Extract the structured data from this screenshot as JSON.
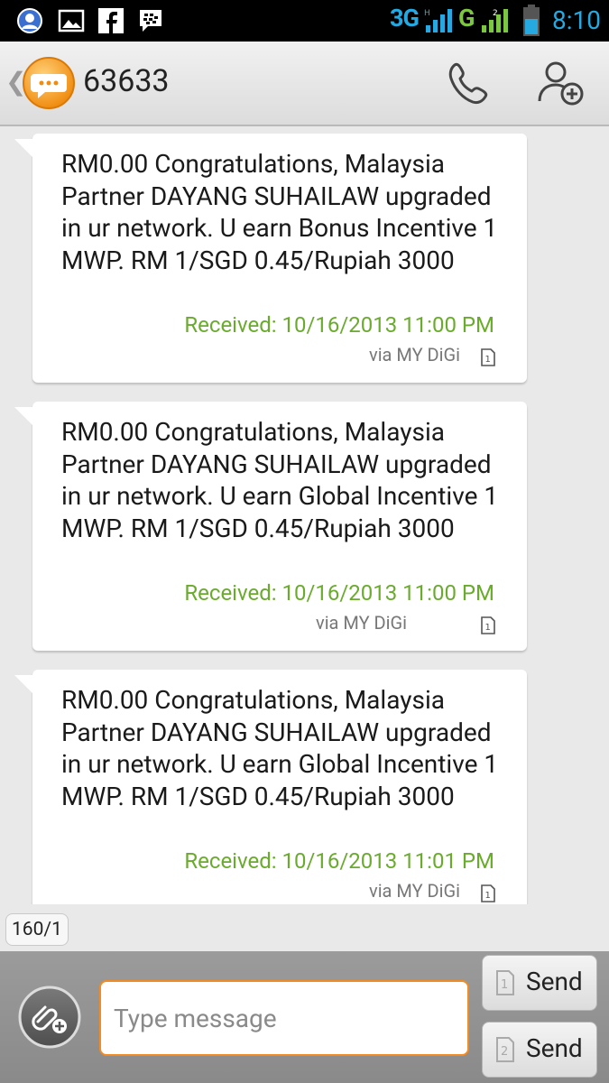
{
  "status_bar": {
    "network": "3G",
    "network_g": "G",
    "time": "8:10"
  },
  "header": {
    "title": "63633"
  },
  "messages": [
    {
      "body": "RM0.00 Congratulations, Malaysia Partner DAYANG SUHAILAW upgraded in ur network. U earn Bonus Incentive 1 MWP. RM 1/SGD 0.45/Rupiah 3000",
      "received": "Received: 10/16/2013 11:00 PM",
      "via": "via MY DiGi",
      "sim": "1"
    },
    {
      "body": "RM0.00 Congratulations, Malaysia Partner DAYANG SUHAILAW upgraded in ur network. U earn Global Incentive 1 MWP. RM 1/SGD 0.45/Rupiah 3000",
      "received": "Received: 10/16/2013 11:00 PM",
      "via": "via MY DiGi",
      "sim": "1"
    },
    {
      "body": "RM0.00 Congratulations, Malaysia Partner DAYANG SUHAILAW upgraded in ur network. U earn Global Incentive 1 MWP. RM 1/SGD 0.45/Rupiah 3000",
      "received": "Received: 10/16/2013 11:01 PM",
      "via": "via MY DiGi",
      "sim": "1"
    }
  ],
  "composer": {
    "char_counter": "160/1",
    "placeholder": "Type message",
    "send_sim1_label": "Send",
    "send_sim1_number": "1",
    "send_sim2_label": "Send",
    "send_sim2_number": "2"
  },
  "colors": {
    "accent": "#f28c22",
    "received_text": "#6aab2e",
    "status_icons": "#25a9e0"
  }
}
